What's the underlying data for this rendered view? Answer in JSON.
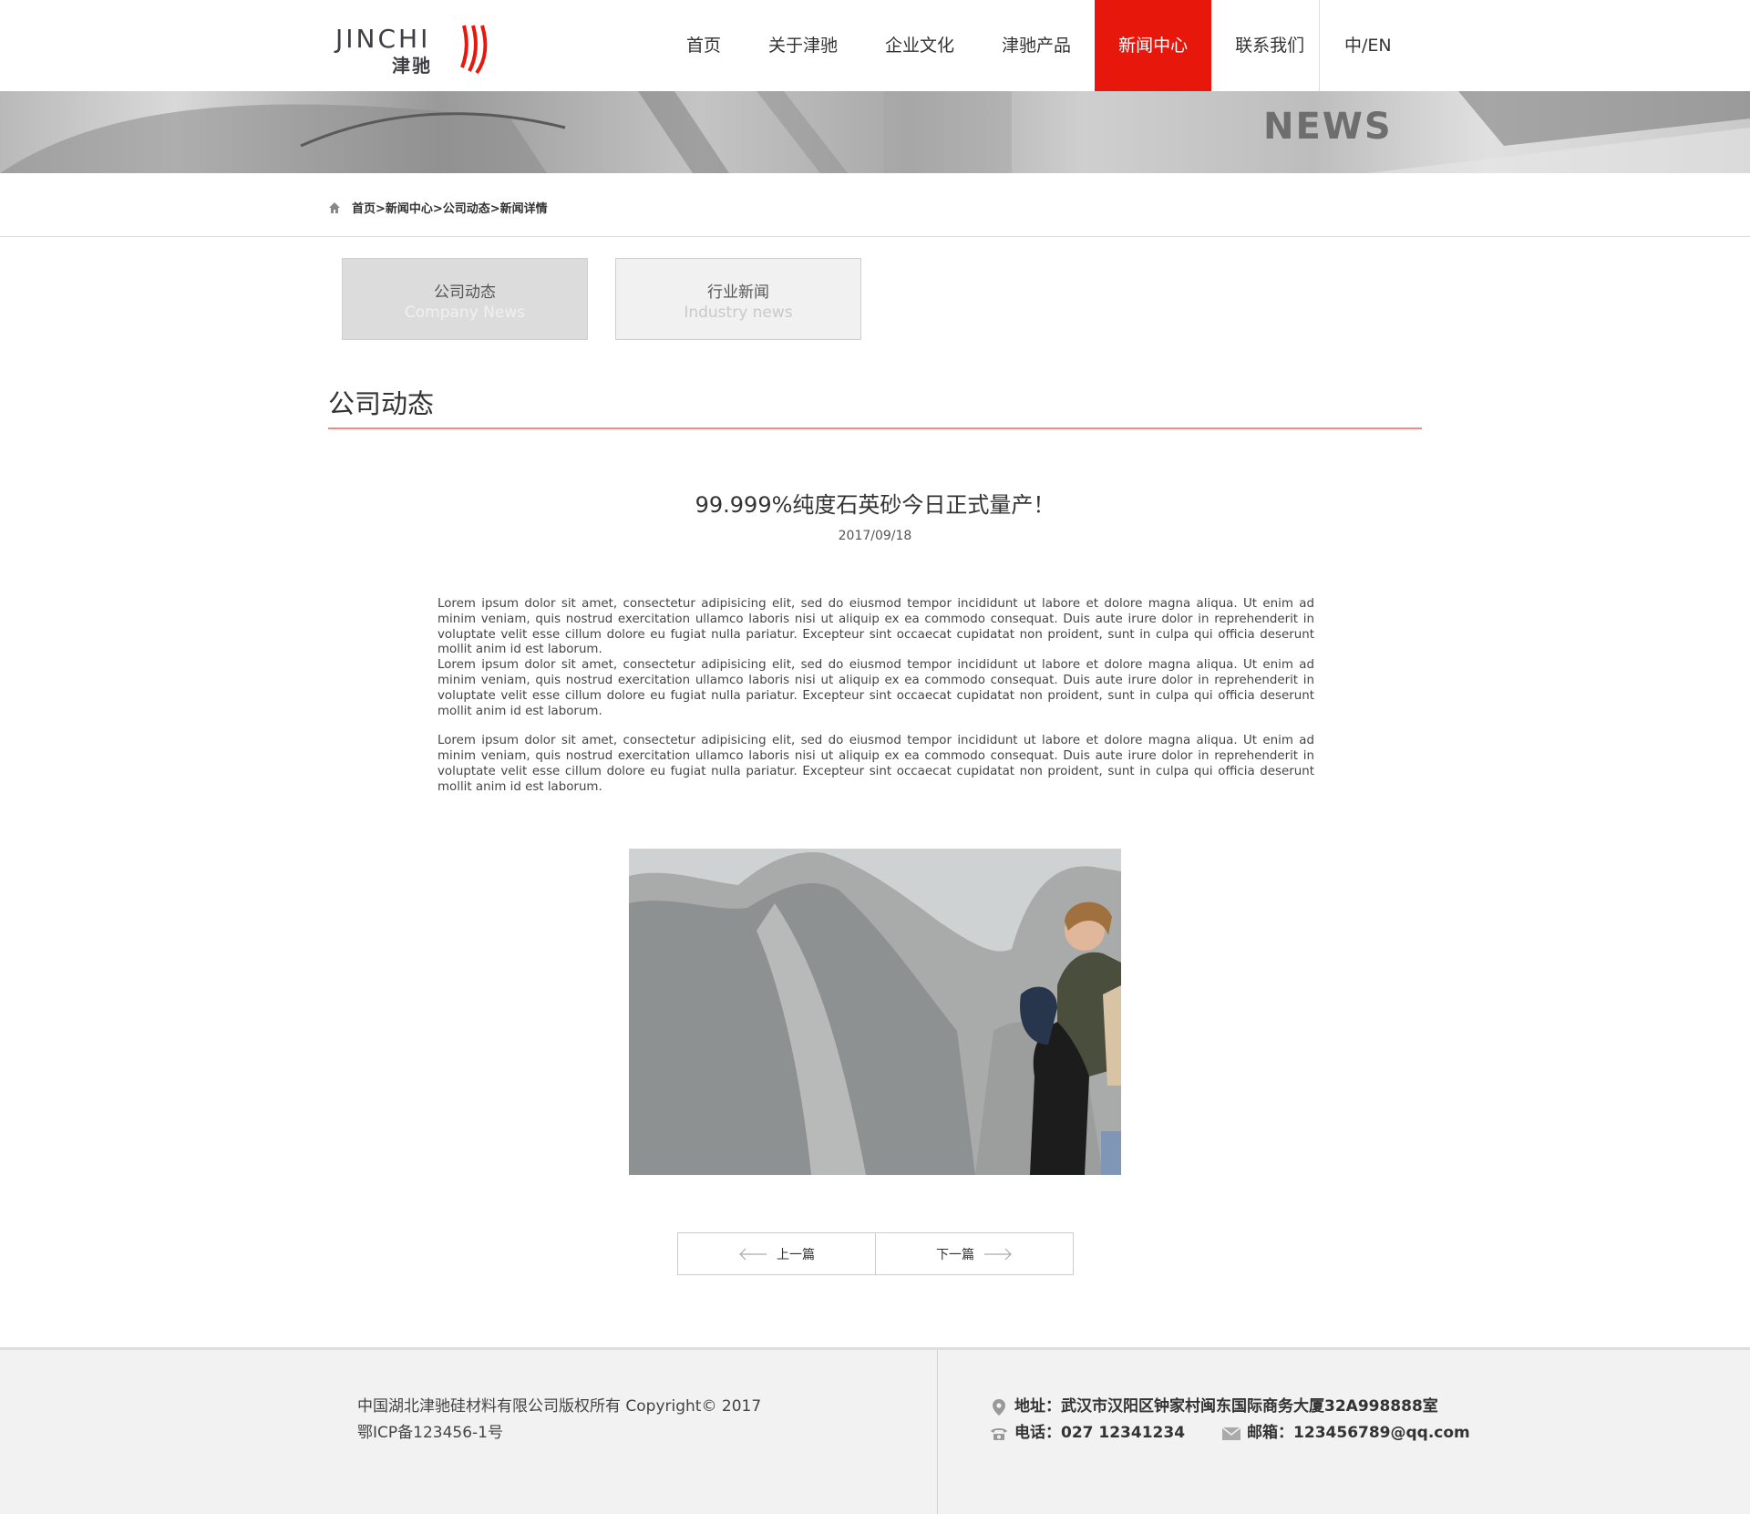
{
  "header": {
    "logo_en": "JINCHI",
    "logo_cn": "津驰",
    "nav": [
      {
        "label": "首页"
      },
      {
        "label": "关于津驰"
      },
      {
        "label": "企业文化"
      },
      {
        "label": "津驰产品"
      },
      {
        "label": "新闻中心",
        "active": true
      },
      {
        "label": "联系我们"
      }
    ],
    "lang": "中/EN",
    "accent_color": "#e8170c"
  },
  "banner": {
    "title": "NEWS"
  },
  "breadcrumb": {
    "text": "首页>新闻中心>公司动态>新闻详情",
    "icon": "home-icon"
  },
  "tabs": [
    {
      "cn": "公司动态",
      "en": "Company News",
      "selected": true
    },
    {
      "cn": "行业新闻",
      "en": "Industry news",
      "selected": false
    }
  ],
  "section": {
    "title": "公司动态"
  },
  "article": {
    "title": "99.999%纯度石英砂今日正式量产！",
    "date": "2017/09/18",
    "paragraphs": [
      "Lorem ipsum dolor sit amet, consectetur adipisicing elit, sed do eiusmod tempor incididunt ut labore et dolore magna aliqua. Ut enim ad minim veniam, quis nostrud exercitation ullamco laboris nisi ut aliquip ex ea commodo consequat. Duis aute irure dolor in reprehenderit in voluptate velit esse cillum dolore eu fugiat nulla pariatur. Excepteur sint occaecat cupidatat non proident, sunt in culpa qui officia deserunt mollit anim id est laborum.",
      "Lorem ipsum dolor sit amet, consectetur adipisicing elit, sed do eiusmod tempor incididunt ut labore et dolore magna aliqua. Ut enim ad minim veniam, quis nostrud exercitation ullamco laboris nisi ut aliquip ex ea commodo consequat. Duis aute irure dolor in reprehenderit in voluptate velit esse cillum dolore eu fugiat nulla pariatur. Excepteur sint occaecat cupidatat non proident, sunt in culpa qui officia deserunt mollit anim id est laborum.",
      "Lorem ipsum dolor sit amet, consectetur adipisicing elit, sed do eiusmod tempor incididunt ut labore et dolore magna aliqua. Ut enim ad minim veniam, quis nostrud exercitation ullamco laboris nisi ut aliquip ex ea commodo consequat. Duis aute irure dolor in reprehenderit in voluptate velit esse cillum dolore eu fugiat nulla pariatur. Excepteur sint occaecat cupidatat non proident, sunt in culpa qui officia deserunt mollit anim id est laborum."
    ]
  },
  "pager": {
    "prev": "上一篇",
    "next": "下一篇"
  },
  "footer": {
    "copyright": "中国湖北津驰硅材料有限公司版权所有 Copyright© 2017",
    "icp": "鄂ICP备123456-1号",
    "address": "地址：武汉市汉阳区钟家村闽东国际商务大厦32A998888室",
    "phone": "电话：027 12341234",
    "email": "邮箱：123456789@qq.com"
  }
}
